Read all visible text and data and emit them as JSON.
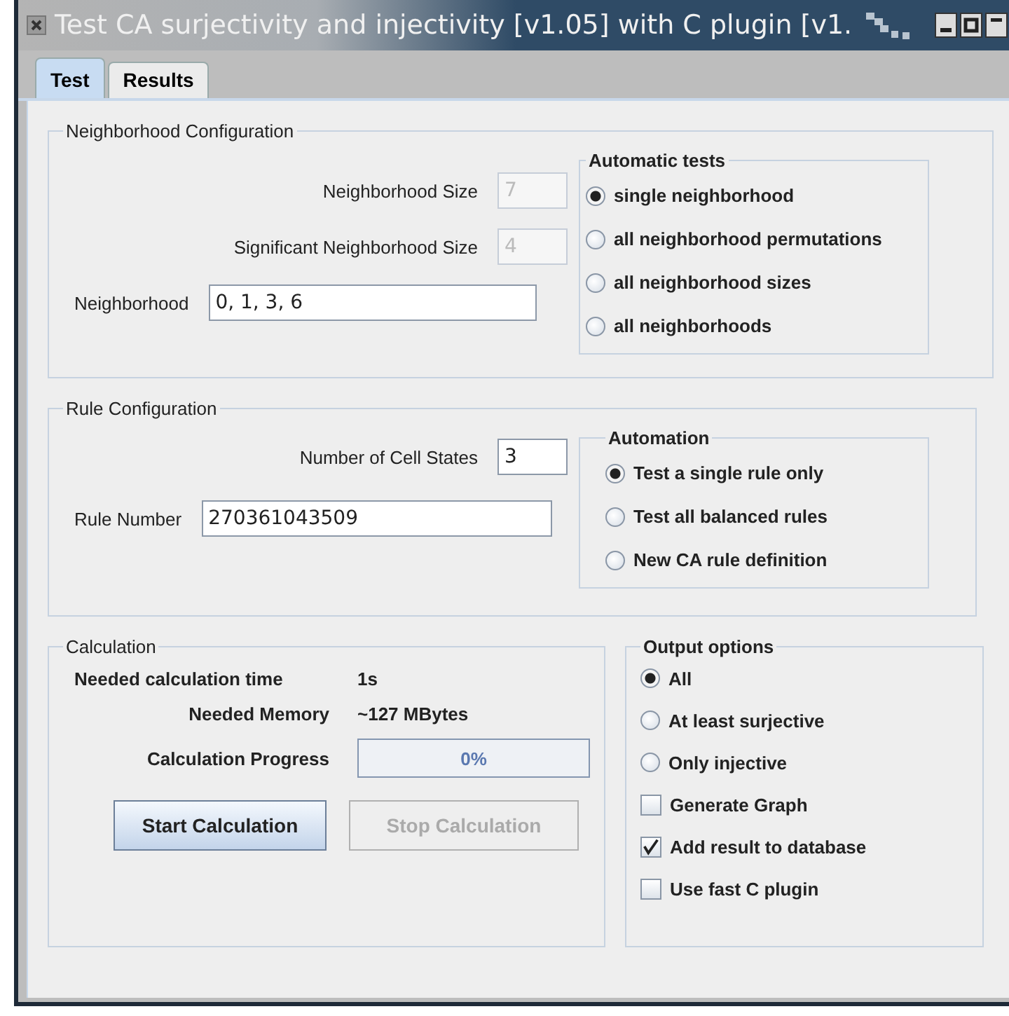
{
  "window": {
    "title": "Test CA surjectivity and injectivity [v1.05] with C plugin [v1."
  },
  "tabs": [
    {
      "label": "Test",
      "selected": true
    },
    {
      "label": "Results",
      "selected": false
    }
  ],
  "neighborhood": {
    "title": "Neighborhood Configuration",
    "fields": [
      {
        "kind": "short",
        "label": "Neighborhood Size",
        "value": "7",
        "disabled": true
      },
      {
        "kind": "short",
        "label": "Significant Neighborhood Size",
        "value": "4",
        "disabled": true
      },
      {
        "kind": "wide",
        "label": "Neighborhood",
        "value": "0, 1, 3, 6",
        "disabled": false
      }
    ],
    "options_group": {
      "title": "Automatic tests",
      "options": [
        {
          "label": "single neighborhood",
          "selected": true
        },
        {
          "label": "all neighborhood permutations",
          "selected": false
        },
        {
          "label": "all neighborhood sizes",
          "selected": false
        },
        {
          "label": "all neighborhoods",
          "selected": false
        }
      ]
    }
  },
  "rule": {
    "title": "Rule Configuration",
    "fields": [
      {
        "kind": "short",
        "label": "Number of Cell States",
        "value": "3",
        "disabled": false
      },
      {
        "kind": "wide",
        "label": "Rule Number",
        "value": "270361043509",
        "disabled": false
      }
    ],
    "options_group": {
      "title": "Automation",
      "options": [
        {
          "label": "Test a single rule only",
          "selected": true
        },
        {
          "label": "Test all balanced rules",
          "selected": false
        },
        {
          "label": "New CA rule definition",
          "selected": false
        }
      ]
    }
  },
  "calculation": {
    "title": "Calculation",
    "info": [
      {
        "label": "Needed calculation time",
        "value": "1s"
      },
      {
        "label": "Needed Memory",
        "value": "~127 MBytes"
      }
    ],
    "progress": {
      "label": "Calculation Progress",
      "level": 0,
      "text": "0%"
    },
    "buttons": [
      {
        "label": "Start Calculation",
        "disabled": false
      },
      {
        "label": "Stop Calculation",
        "disabled": true
      }
    ]
  },
  "output_options": {
    "title": "Output options",
    "items": [
      {
        "kind": "radio",
        "label": "All",
        "selected": true
      },
      {
        "kind": "radio",
        "label": "At least surjective",
        "selected": false
      },
      {
        "kind": "radio",
        "label": "Only injective",
        "selected": false
      },
      {
        "kind": "checkbox",
        "label": "Generate Graph",
        "checked": false
      },
      {
        "kind": "checkbox",
        "label": "Add result to database",
        "checked": true
      },
      {
        "kind": "checkbox",
        "label": "Use fast C plugin",
        "checked": false
      }
    ]
  }
}
